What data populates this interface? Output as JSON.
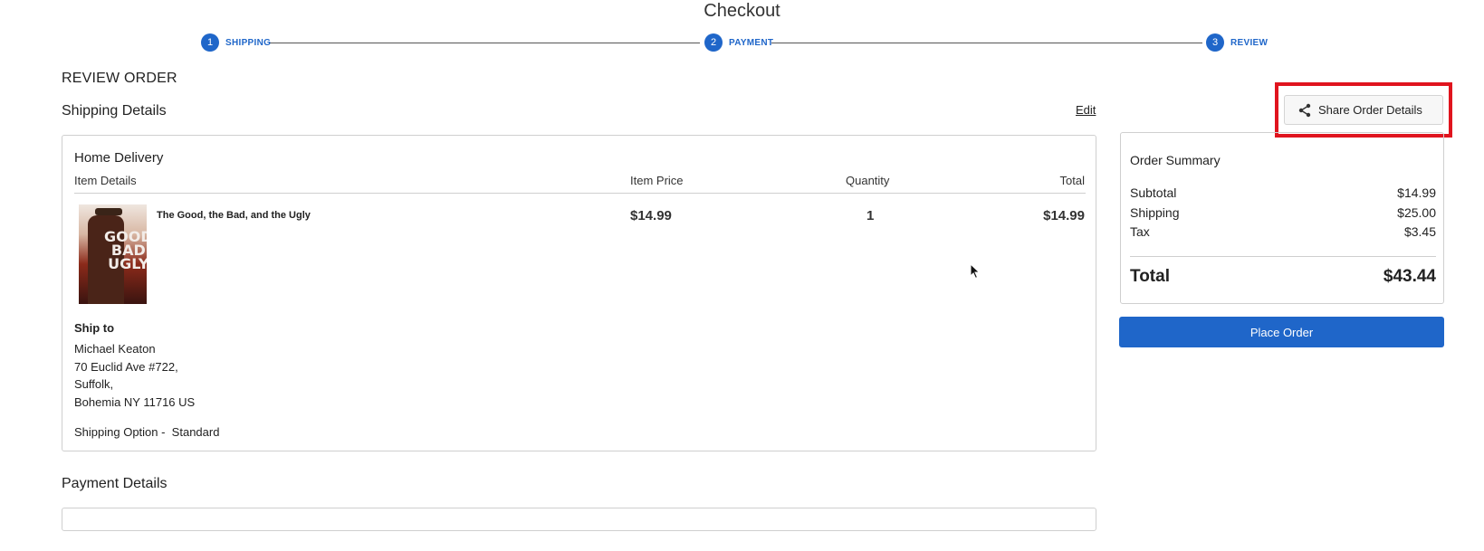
{
  "page": {
    "title": "Checkout"
  },
  "stepper": {
    "steps": [
      {
        "number": "1",
        "label": "SHIPPING"
      },
      {
        "number": "2",
        "label": "PAYMENT"
      },
      {
        "number": "3",
        "label": "REVIEW"
      }
    ]
  },
  "review": {
    "heading": "REVIEW ORDER",
    "shipping_heading": "Shipping Details",
    "edit_label": "Edit",
    "delivery_title": "Home Delivery",
    "columns": {
      "item_details": "Item Details",
      "item_price": "Item Price",
      "quantity": "Quantity",
      "total": "Total"
    },
    "item": {
      "poster_text": "GOOD BAD UGLY",
      "name": "The Good, the Bad, and the Ugly",
      "price": "$14.99",
      "quantity": "1",
      "total": "$14.99"
    },
    "ship_to": {
      "label": "Ship to",
      "lines": [
        "Michael Keaton",
        "70 Euclid Ave #722,",
        "Suffolk,",
        "Bohemia NY 11716 US"
      ]
    },
    "shipping_option": "Shipping Option -  Standard",
    "payment_heading": "Payment Details"
  },
  "share": {
    "label": "Share Order Details",
    "icon": "share-icon"
  },
  "summary": {
    "title": "Order Summary",
    "rows": [
      {
        "label": "Subtotal",
        "value": "$14.99"
      },
      {
        "label": "Shipping",
        "value": "$25.00"
      },
      {
        "label": "Tax",
        "value": "$3.45"
      }
    ],
    "total_label": "Total",
    "total_value": "$43.44"
  },
  "actions": {
    "place_order": "Place Order"
  },
  "colors": {
    "accent": "#1f66c9",
    "highlight": "#e0141e"
  }
}
